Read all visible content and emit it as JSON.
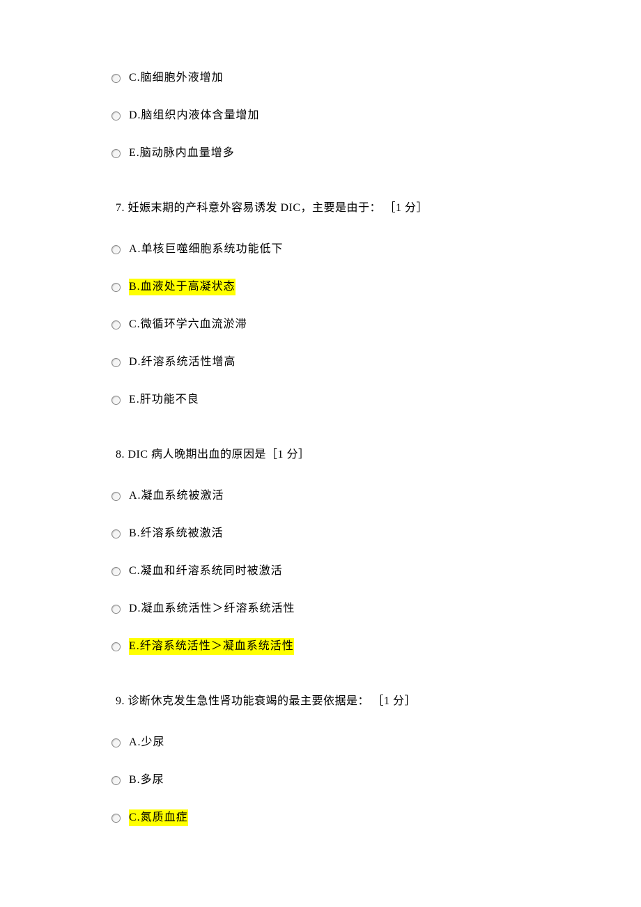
{
  "leading_options": [
    {
      "text": "C.脑细胞外液增加",
      "highlighted": false
    },
    {
      "text": "D.脑组织内液体含量增加",
      "highlighted": false
    },
    {
      "text": "E.脑动脉内血量增多",
      "highlighted": false
    }
  ],
  "questions": [
    {
      "prompt": "7. 妊娠末期的产科意外容易诱发 DIC，主要是由于： ［1 分］",
      "options": [
        {
          "text": "A.单核巨噬细胞系统功能低下",
          "highlighted": false
        },
        {
          "text": "B.血液处于高凝状态",
          "highlighted": true
        },
        {
          "text": "C.微循环学六血流淤滞",
          "highlighted": false
        },
        {
          "text": "D.纤溶系统活性增高",
          "highlighted": false
        },
        {
          "text": "E.肝功能不良",
          "highlighted": false
        }
      ]
    },
    {
      "prompt": "8. DIC 病人晚期出血的原因是［1 分］",
      "options": [
        {
          "text": "A.凝血系统被激活",
          "highlighted": false
        },
        {
          "text": "B.纤溶系统被激活",
          "highlighted": false
        },
        {
          "text": "C.凝血和纤溶系统同时被激活",
          "highlighted": false
        },
        {
          "text": "D.凝血系统活性＞纤溶系统活性",
          "highlighted": false
        },
        {
          "text": "E.纤溶系统活性＞凝血系统活性",
          "highlighted": true
        }
      ]
    },
    {
      "prompt": "9. 诊断休克发生急性肾功能衰竭的最主要依据是： ［1 分］",
      "options": [
        {
          "text": "A.少尿",
          "highlighted": false
        },
        {
          "text": "B.多尿",
          "highlighted": false
        },
        {
          "text": "C.氮质血症",
          "highlighted": true
        }
      ]
    }
  ]
}
